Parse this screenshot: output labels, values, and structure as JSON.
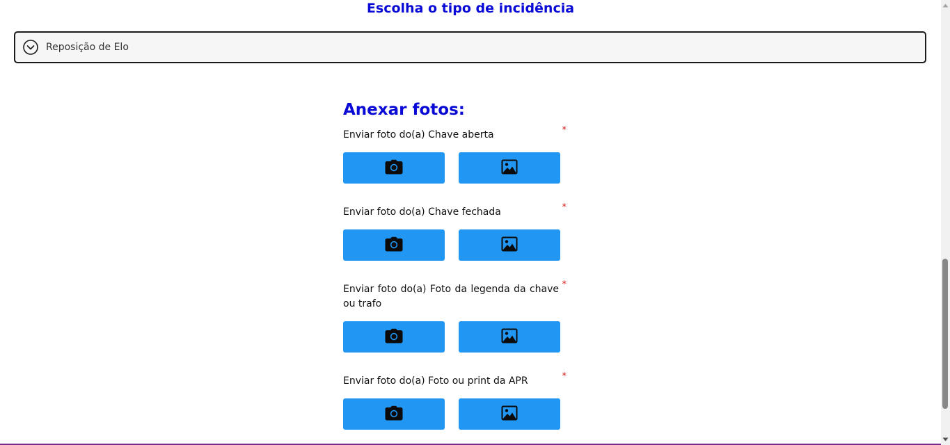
{
  "incidence": {
    "title": "Escolha o tipo de incidência",
    "selected": "Reposição de Elo"
  },
  "attachments": {
    "title": "Anexar fotos:",
    "required_mark": "*",
    "items": [
      {
        "label": "Enviar foto do(a) Chave aberta"
      },
      {
        "label": "Enviar foto do(a) Chave fechada"
      },
      {
        "label": "Enviar foto do(a) Foto da legenda da chave ou trafo"
      },
      {
        "label": "Enviar foto do(a) Foto ou print da APR"
      }
    ]
  },
  "icons": {
    "dropdown": "chevron-down-circle-icon",
    "camera": "camera-icon",
    "gallery": "image-icon"
  },
  "colors": {
    "heading": "#0a0ad6",
    "button": "#2196f3",
    "required": "#d41919"
  }
}
